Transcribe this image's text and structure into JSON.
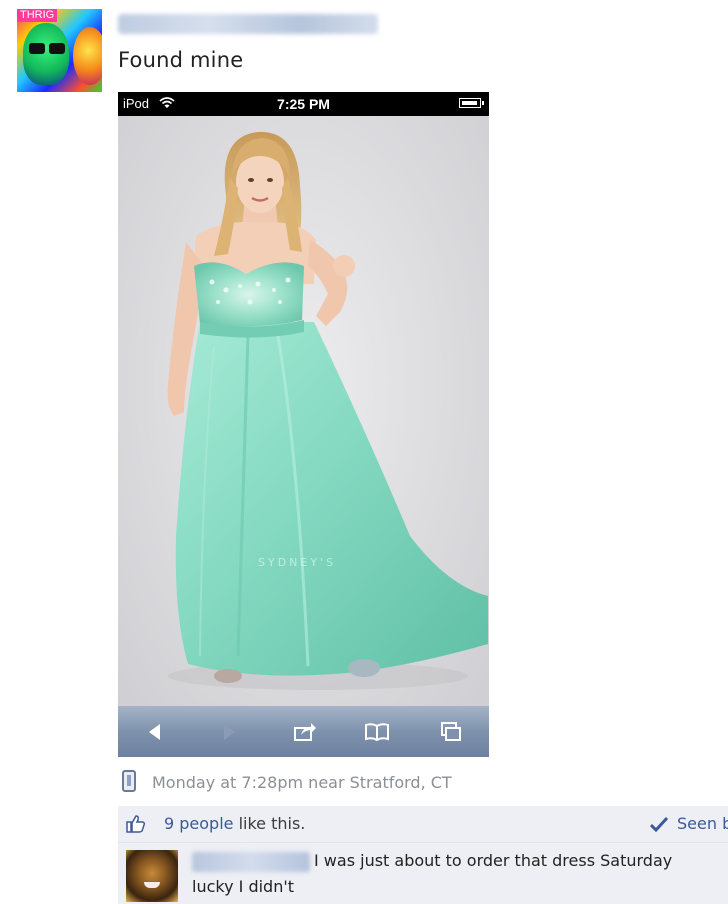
{
  "post": {
    "text": "Found mine",
    "avatar_tag": "THRIG"
  },
  "phone": {
    "status": {
      "device": "iPod",
      "time": "7:25 PM"
    },
    "photo": {
      "watermark": "SYDNEY'S"
    }
  },
  "meta": {
    "text": "Monday at 7:28pm near Stratford, CT"
  },
  "likes": {
    "count_link": "9 people",
    "suffix": "like this.",
    "seen_label": "Seen b"
  },
  "comment": {
    "line1": "I was just about to order that dress Saturday",
    "line2": "lucky I didn't"
  },
  "colors": {
    "link": "#3b5998",
    "likes_bg": "#edeff4",
    "dress": "#8fdcc4",
    "meta_text": "#8b8f96"
  },
  "icons": [
    "wifi-icon",
    "battery-icon",
    "back-arrow-icon",
    "forward-arrow-icon",
    "share-icon",
    "bookmarks-icon",
    "tabs-icon",
    "mobile-device-icon",
    "like-thumb-icon",
    "seen-check-icon"
  ]
}
